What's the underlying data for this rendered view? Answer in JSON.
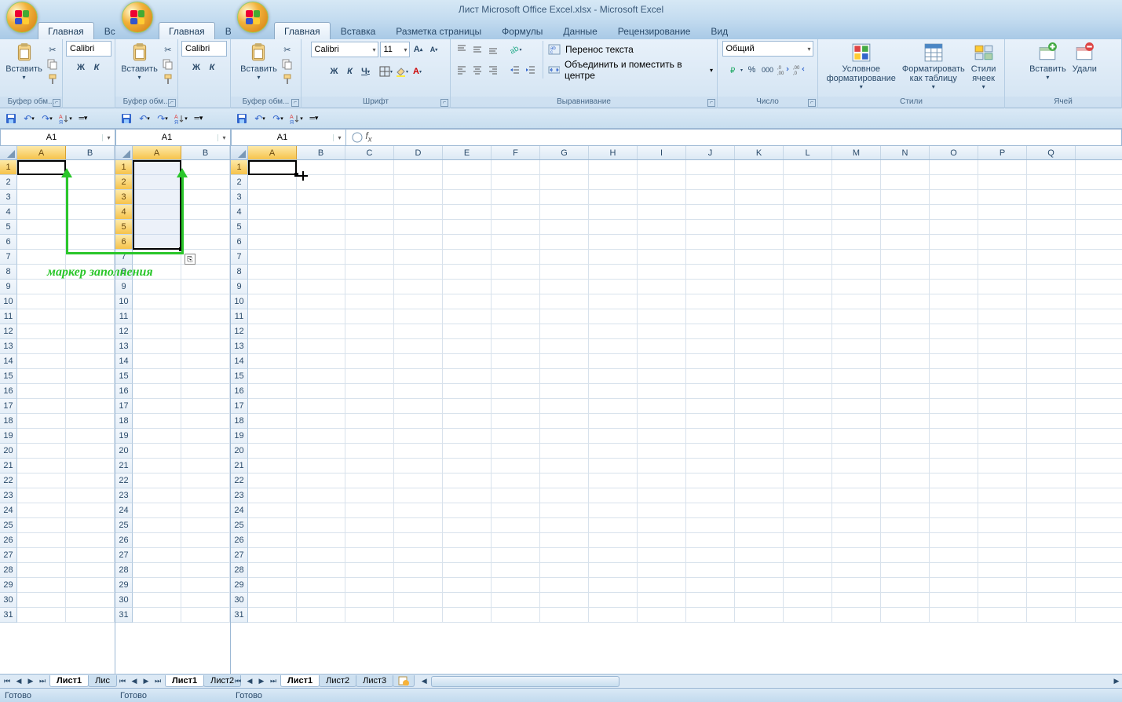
{
  "title": "Лист Microsoft Office Excel.xlsx - Microsoft Excel",
  "tabs_partial": {
    "active": "Главная",
    "cut": "Вста"
  },
  "tabs_full": [
    "Главная",
    "Вставка",
    "Разметка страницы",
    "Формулы",
    "Данные",
    "Рецензирование",
    "Вид"
  ],
  "ribbon": {
    "clipboard": {
      "paste": "Вставить",
      "label": "Буфер обм..."
    },
    "font": {
      "name": "Calibri",
      "size": "11",
      "label": "Шрифт",
      "bold": "Ж",
      "italic": "К",
      "underline": "Ч"
    },
    "alignment": {
      "wrap": "Перенос текста",
      "merge": "Объединить и поместить в центре",
      "label": "Выравнивание"
    },
    "number": {
      "format": "Общий",
      "label": "Число"
    },
    "styles": {
      "cond": "Условное",
      "cond2": "форматирование",
      "fmttbl": "Форматировать",
      "fmttbl2": "как таблицу",
      "cellst": "Стили",
      "cellst2": "ячеек",
      "label": "Стили"
    },
    "cells": {
      "insert": "Вставить",
      "delete": "Удали",
      "label": "Ячей"
    }
  },
  "namebox": "A1",
  "columns_narrow": [
    "A",
    "B"
  ],
  "columns_wide": [
    "A",
    "B",
    "C",
    "D",
    "E",
    "F",
    "G",
    "H",
    "I",
    "J",
    "K",
    "L",
    "M",
    "N",
    "O",
    "P",
    "Q"
  ],
  "rows": [
    1,
    2,
    3,
    4,
    5,
    6,
    7,
    8,
    9,
    10,
    11,
    12,
    13,
    14,
    15,
    16,
    17,
    18,
    19,
    20,
    21,
    22,
    23,
    24,
    25,
    26,
    27,
    28,
    29,
    30,
    31
  ],
  "sheets_partial": [
    "Лист1",
    "Лис"
  ],
  "sheets_partial2": [
    "Лист1",
    "Лист2"
  ],
  "sheets_full": [
    "Лист1",
    "Лист2",
    "Лист3"
  ],
  "status": "Готово",
  "annotation": "маркер заполнения"
}
